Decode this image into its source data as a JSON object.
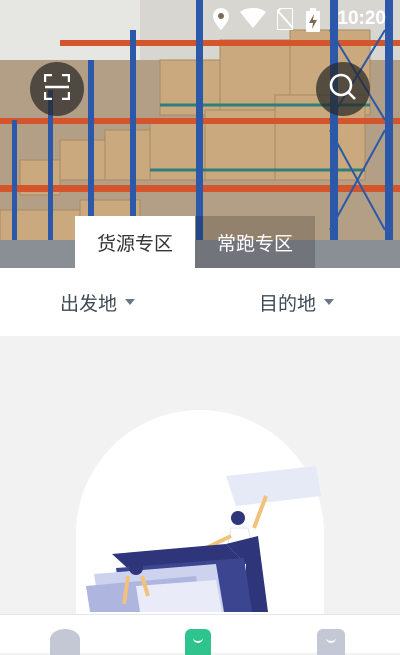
{
  "status_bar": {
    "time": "10:20",
    "icons": [
      "location-icon",
      "wifi-icon",
      "no-sim-icon",
      "battery-charging-icon"
    ]
  },
  "header": {
    "scan_icon": "scan-icon",
    "search_icon": "search-icon"
  },
  "tabs": [
    {
      "label": "货源专区",
      "active": true
    },
    {
      "label": "常跑专区",
      "active": false
    }
  ],
  "filters": {
    "origin_label": "出发地",
    "destination_label": "目的地"
  },
  "colors": {
    "accent_green": "#2fc48d",
    "nav_gray": "#c3c8d4",
    "text_dark": "#3d4a57",
    "illustration_navy": "#2e357a"
  },
  "bottom_nav": {
    "items": [
      {
        "icon": "home-icon",
        "active": false
      },
      {
        "icon": "cargo-icon",
        "active": true
      },
      {
        "icon": "profile-icon",
        "active": false
      }
    ]
  }
}
